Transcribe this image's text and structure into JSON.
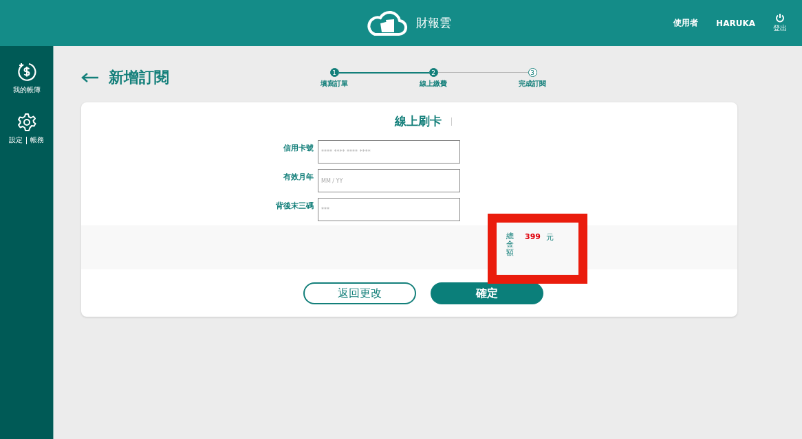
{
  "header": {
    "brand": "財報雲",
    "user_label": "使用者",
    "user_name": "HARUKA",
    "logout": "登出"
  },
  "sidebar": {
    "items": [
      {
        "kind": "ledger",
        "labels": [
          "我的帳簿"
        ]
      },
      {
        "kind": "settings",
        "labels": [
          "設定",
          "帳務"
        ]
      }
    ]
  },
  "page": {
    "title": "新增訂閱"
  },
  "steps": [
    {
      "number": "1",
      "label": "填寫訂單",
      "completed": true
    },
    {
      "number": "2",
      "label": "線上繳費",
      "completed": true
    },
    {
      "number": "3",
      "label": "完成訂閱",
      "completed": false
    }
  ],
  "form": {
    "title": "線上刷卡",
    "fields": [
      {
        "label": "信用卡號",
        "placeholder": "**** **** **** ****"
      },
      {
        "label": "有效月年",
        "placeholder": "MM / YY"
      },
      {
        "label": "背後末三碼",
        "placeholder": "***"
      }
    ]
  },
  "total": {
    "label": "總金額",
    "amount": "399",
    "unit": "元",
    "highlighted": true
  },
  "buttons": [
    {
      "kind": "secondary",
      "label": "返回更改"
    },
    {
      "kind": "primary",
      "label": "確定"
    }
  ]
}
